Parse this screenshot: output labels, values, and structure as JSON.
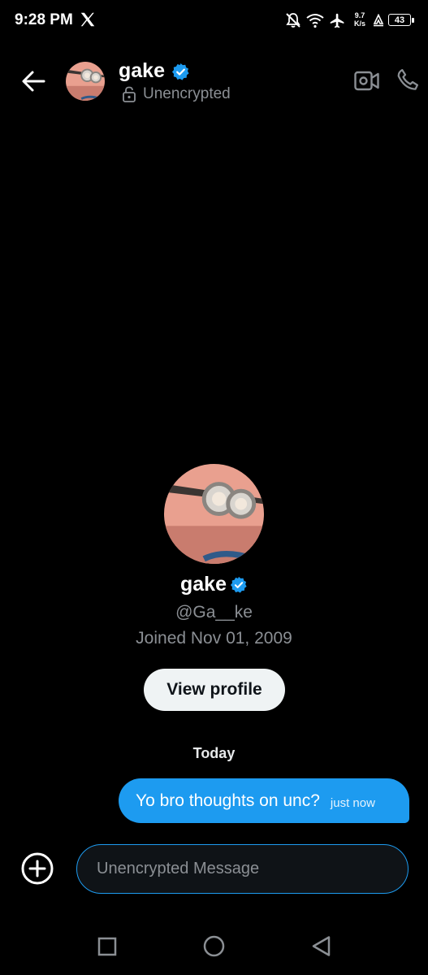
{
  "status_bar": {
    "time": "9:28 PM",
    "speed_value": "9.7",
    "speed_unit": "K/s",
    "battery": "43",
    "icons": [
      "x-logo-icon",
      "mute-bell-icon",
      "wifi-icon",
      "airplane-icon",
      "data-saver-icon",
      "battery-icon"
    ]
  },
  "header": {
    "name": "gake",
    "encryption_status": "Unencrypted",
    "icons": [
      "back-arrow-icon",
      "verified-badge-icon",
      "lock-icon",
      "video-call-icon",
      "phone-call-icon"
    ]
  },
  "profile": {
    "name": "gake",
    "handle": "@Ga__ke",
    "joined": "Joined Nov 01, 2009",
    "view_profile_label": "View profile"
  },
  "conversation": {
    "day_separator": "Today",
    "messages": [
      {
        "text": "Yo bro thoughts on unc?",
        "time": "just now",
        "outgoing": true
      }
    ]
  },
  "composer": {
    "placeholder": "Unencrypted Message",
    "value": ""
  },
  "colors": {
    "accent": "#1d9bf0",
    "background": "#000000",
    "muted_text": "#8b8f94",
    "button_light": "#eff3f4"
  }
}
